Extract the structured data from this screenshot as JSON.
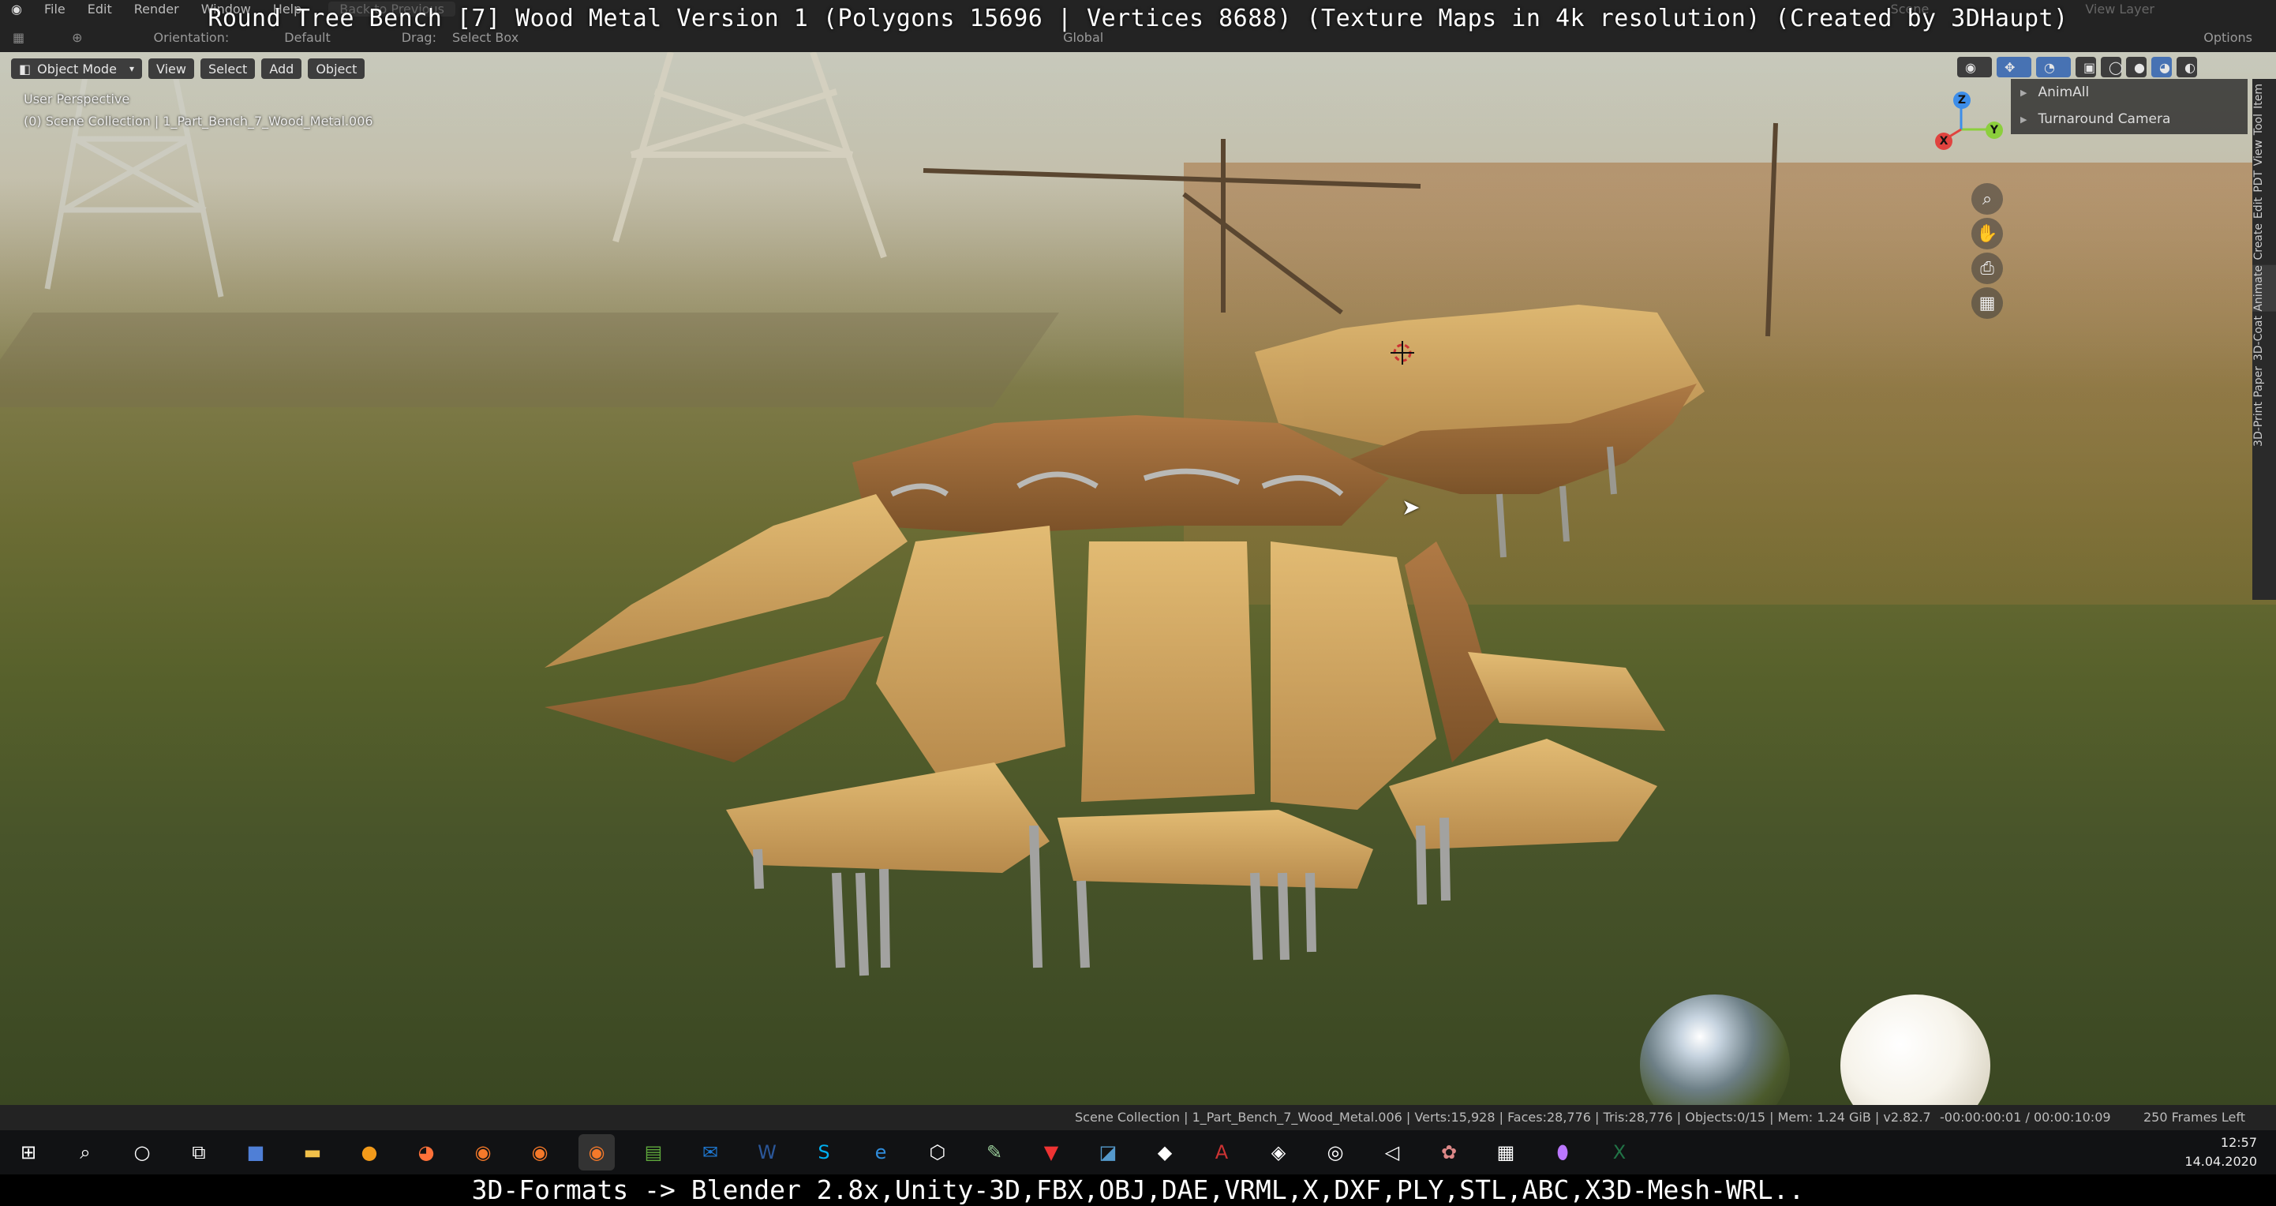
{
  "window": {
    "overlay_title": "Round Tree Bench [7] Wood Metal Version 1 (Polygons 15696 | Vertices 8688) (Texture Maps in 4k resolution) (Created by 3DHaupt)"
  },
  "menubar": {
    "items": [
      "File",
      "Edit",
      "Render",
      "Window",
      "Help"
    ],
    "back_label": "Back to Previous",
    "scene": "Scene",
    "view_layer": "View Layer"
  },
  "toolbar": {
    "orientation_label": "Orientation:",
    "orientation_value": "Default",
    "drag_label": "Drag:",
    "drag_value": "Select Box",
    "transform_value": "Global",
    "options_label": "Options"
  },
  "viewport_header": {
    "mode": "Object Mode",
    "menus": [
      "View",
      "Select",
      "Add",
      "Object"
    ]
  },
  "viewport_info": {
    "perspective": "User Perspective",
    "collection": "(0) Scene Collection | 1_Part_Bench_7_Wood_Metal.006"
  },
  "gizmo": {
    "x": "X",
    "y": "Y",
    "z": "Z"
  },
  "npanel": {
    "items": [
      "AnimAll",
      "Turnaround Camera"
    ],
    "tabs": [
      "Item",
      "Tool",
      "View",
      "PDT",
      "Edit",
      "Create",
      "Animate",
      "3D-Coat",
      "Paper",
      "3D-Print"
    ]
  },
  "statusbar": {
    "stats": "Scene Collection | 1_Part_Bench_7_Wood_Metal.006 | Verts:15,928 | Faces:28,776 | Tris:28,776 | Objects:0/15 | Mem: 1.24 GiB | v2.82.7",
    "time": "-00:00:00:01 / 00:00:10:09",
    "frames_left": "250 Frames Left"
  },
  "taskbar": {
    "icons": [
      "windows-start-icon",
      "search-icon",
      "cortana-icon",
      "task-view-icon",
      "save-icon",
      "file-explorer-icon",
      "blender-orange-icon",
      "firefox-icon",
      "blender-icon",
      "blender-icon",
      "blender-icon",
      "spreadsheet-icon",
      "outlook-icon",
      "word-icon",
      "skype-icon",
      "edge-icon",
      "cube-icon",
      "tool-icon",
      "vectorworks-icon",
      "sketch-icon",
      "app-icon",
      "access-icon",
      "unity-icon",
      "unity-hub-icon",
      "terminal-icon",
      "paint-icon",
      "calculator-icon",
      "maps-icon",
      "excel-icon"
    ],
    "time": "12:57",
    "date": "14.04.2020"
  },
  "caption": "3D-Formats -> Blender 2.8x,Unity-3D,FBX,OBJ,DAE,VRML,X,DXF,PLY,STL,ABC,X3D-Mesh-WRL..",
  "colors": {
    "blender_bg": "#232323",
    "button_bg": "#3d3d3d",
    "gizmo_x": "#e0433f",
    "gizmo_y": "#8ccf3c",
    "gizmo_z": "#3d8eea",
    "wood_light": "#d9b06a",
    "wood_dark": "#8a5a2e"
  }
}
